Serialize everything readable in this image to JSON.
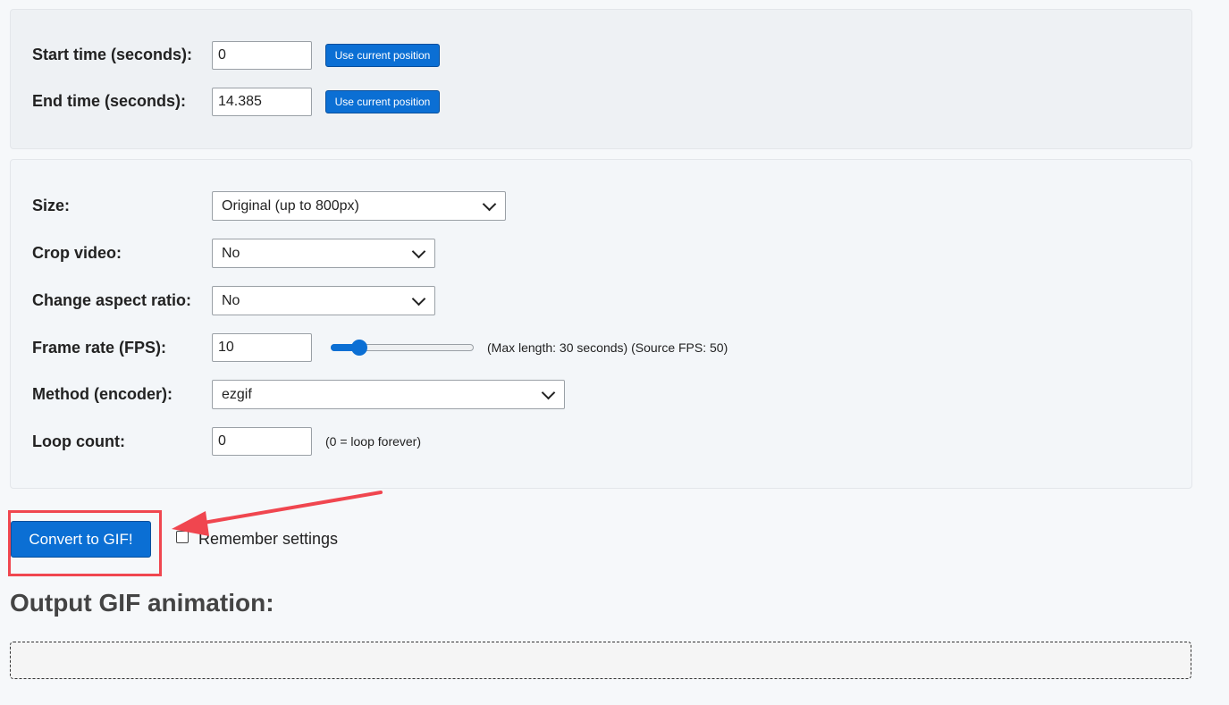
{
  "time": {
    "start_label": "Start time (seconds):",
    "start_value": "0",
    "end_label": "End time (seconds):",
    "end_value": "14.385",
    "use_current_label": "Use current position"
  },
  "options": {
    "size_label": "Size:",
    "size_value": "Original (up to 800px)",
    "crop_label": "Crop video:",
    "crop_value": "No",
    "aspect_label": "Change aspect ratio:",
    "aspect_value": "No",
    "fps_label": "Frame rate (FPS):",
    "fps_value": "10",
    "fps_note": "(Max length: 30 seconds) (Source FPS: 50)",
    "fps_slider_fraction": 0.2,
    "method_label": "Method (encoder):",
    "method_value": "ezgif",
    "loop_label": "Loop count:",
    "loop_value": "0",
    "loop_note": "(0 = loop forever)"
  },
  "actions": {
    "convert_label": "Convert to GIF!",
    "remember_label": "Remember settings",
    "remember_checked": false
  },
  "output": {
    "heading": "Output GIF animation:"
  },
  "colors": {
    "accent": "#0b6fd4",
    "annotation": "#f0464f"
  },
  "icons": [
    "chevron-down-icon",
    "arrow-annotation"
  ]
}
